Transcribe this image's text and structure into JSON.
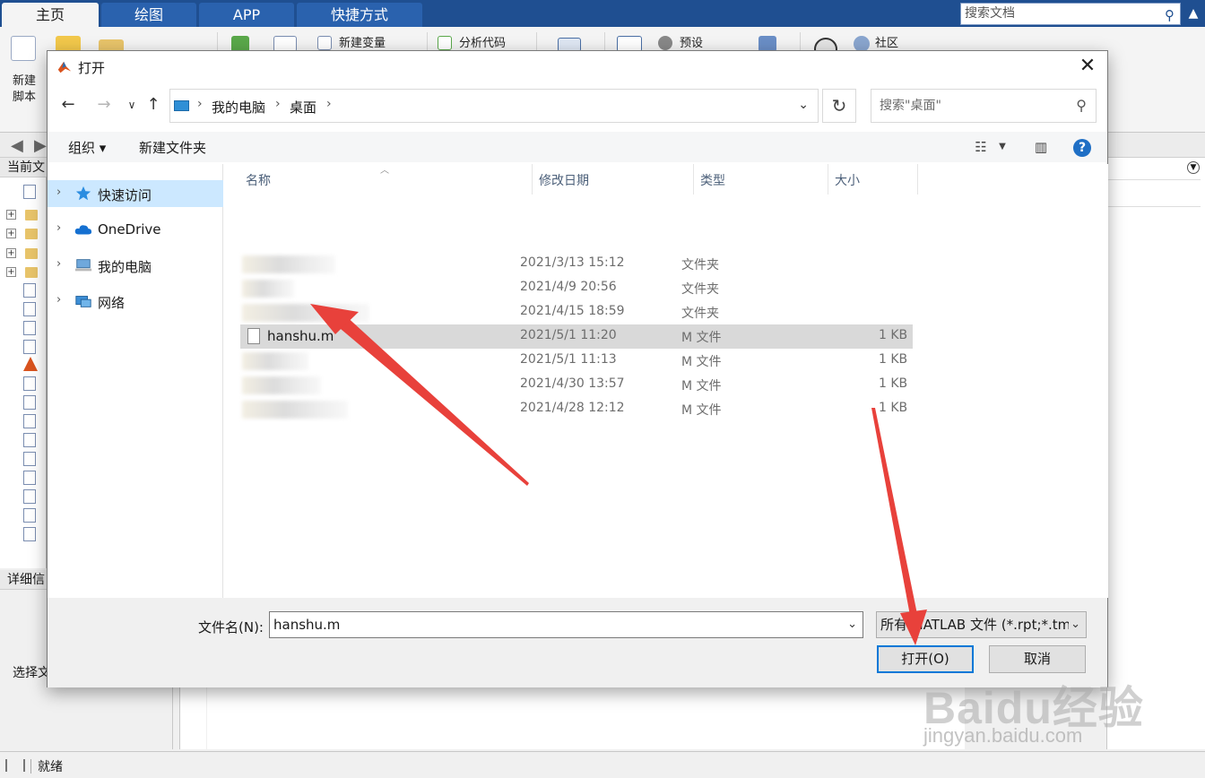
{
  "matlab": {
    "tabs": [
      "主页",
      "绘图",
      "APP",
      "快捷方式"
    ],
    "search_placeholder": "搜索文档",
    "ribbon": {
      "new_script_line1": "新建",
      "new_script_line2": "脚本",
      "new_variable": "新建变量",
      "analyze_code": "分析代码",
      "preferences": "预设",
      "community": "社区"
    },
    "current_folder_label": "当前文",
    "details_label": "详细信",
    "select_hint": "选择文",
    "status": "就绪"
  },
  "dialog": {
    "title": "打开",
    "close_glyph": "✕",
    "address": {
      "segments": [
        "我的电脑",
        "桌面"
      ],
      "search_placeholder": "搜索\"桌面\""
    },
    "commands": {
      "organize": "组织 ▾",
      "new_folder": "新建文件夹",
      "help": "?"
    },
    "nav_pane": [
      {
        "label": "快速访问",
        "icon": "star-icon",
        "selected": true
      },
      {
        "label": "OneDrive",
        "icon": "cloud-icon",
        "selected": false
      },
      {
        "label": "我的电脑",
        "icon": "computer-icon",
        "selected": false
      },
      {
        "label": "网络",
        "icon": "network-icon",
        "selected": false
      }
    ],
    "columns": {
      "name": "名称",
      "date": "修改日期",
      "type": "类型",
      "size": "大小"
    },
    "rows": [
      {
        "name": "",
        "date": "2021/3/13 15:12",
        "type": "文件夹",
        "size": "",
        "blurred": true,
        "selected": false
      },
      {
        "name": "",
        "date": "2021/4/9 20:56",
        "type": "文件夹",
        "size": "",
        "blurred": true,
        "selected": false
      },
      {
        "name": "",
        "date": "2021/4/15 18:59",
        "type": "文件夹",
        "size": "",
        "blurred": true,
        "selected": false
      },
      {
        "name": "hanshu.m",
        "date": "2021/5/1 11:20",
        "type": "M 文件",
        "size": "1 KB",
        "blurred": false,
        "selected": true
      },
      {
        "name": "",
        "date": "2021/5/1 11:13",
        "type": "M 文件",
        "size": "1 KB",
        "blurred": true,
        "selected": false
      },
      {
        "name": "",
        "date": "2021/4/30 13:57",
        "type": "M 文件",
        "size": "1 KB",
        "blurred": true,
        "selected": false
      },
      {
        "name": "",
        "date": "2021/4/28 12:12",
        "type": "M 文件",
        "size": "1 KB",
        "blurred": true,
        "selected": false
      }
    ],
    "footer": {
      "filename_label": "文件名(N):",
      "filename_value": "hanshu.m",
      "filetype_value": "所有 MATLAB 文件 (*.rpt;*.tm",
      "open_button": "打开(O)",
      "cancel_button": "取消"
    }
  },
  "watermark": {
    "brand": "Baidu经验",
    "url": "jingyan.baidu.com"
  },
  "colors": {
    "matlab_tabbar": "#1f4f91",
    "selection_blue": "#cce8ff",
    "primary_border": "#0078d7",
    "arrow_red": "#e8413b"
  }
}
